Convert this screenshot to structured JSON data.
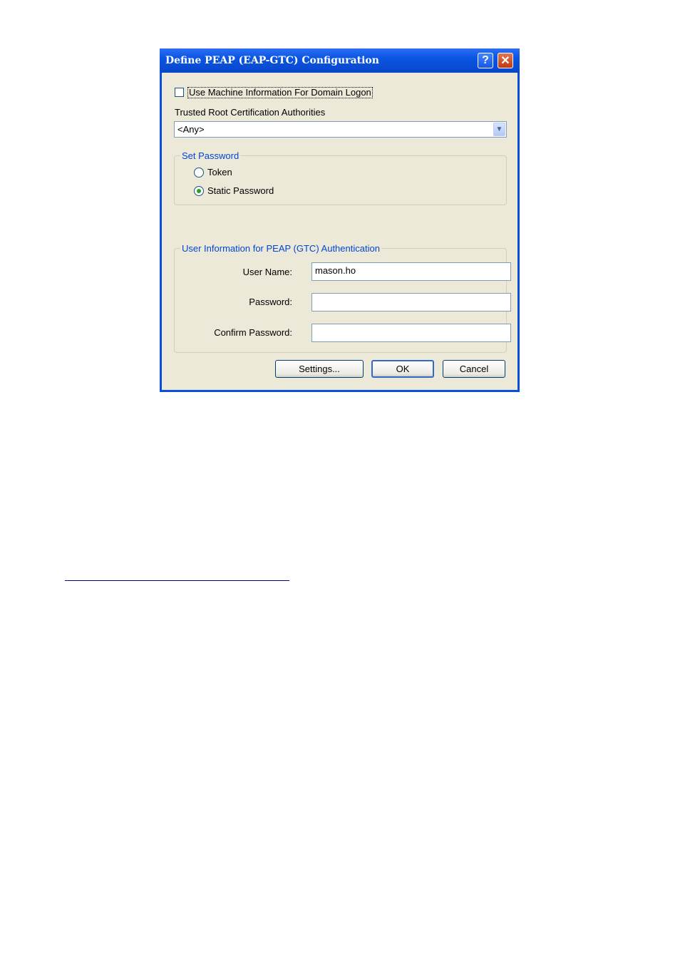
{
  "dialog": {
    "title": "Define PEAP (EAP-GTC) Configuration",
    "help_glyph": "?",
    "close_glyph": "✕"
  },
  "machine_info": {
    "label": "Use Machine Information For Domain Logon",
    "checked": false
  },
  "trusted_root": {
    "label": "Trusted Root Certification Authorities",
    "selected": "<Any>"
  },
  "set_password": {
    "legend": "Set Password",
    "options": [
      {
        "label": "Token",
        "selected": false
      },
      {
        "label": "Static Password",
        "selected": true
      }
    ]
  },
  "user_info": {
    "legend": "User Information for PEAP (GTC) Authentication",
    "username_label": "User Name:",
    "username_value": "mason.ho",
    "password_label": "Password:",
    "password_value": "",
    "confirm_label": "Confirm Password:",
    "confirm_value": ""
  },
  "buttons": {
    "settings": "Settings...",
    "ok": "OK",
    "cancel": "Cancel"
  },
  "colors": {
    "titlebar": "#0a55e3",
    "group_legend": "#0046d5",
    "dialog_face": "#ece9d8"
  }
}
